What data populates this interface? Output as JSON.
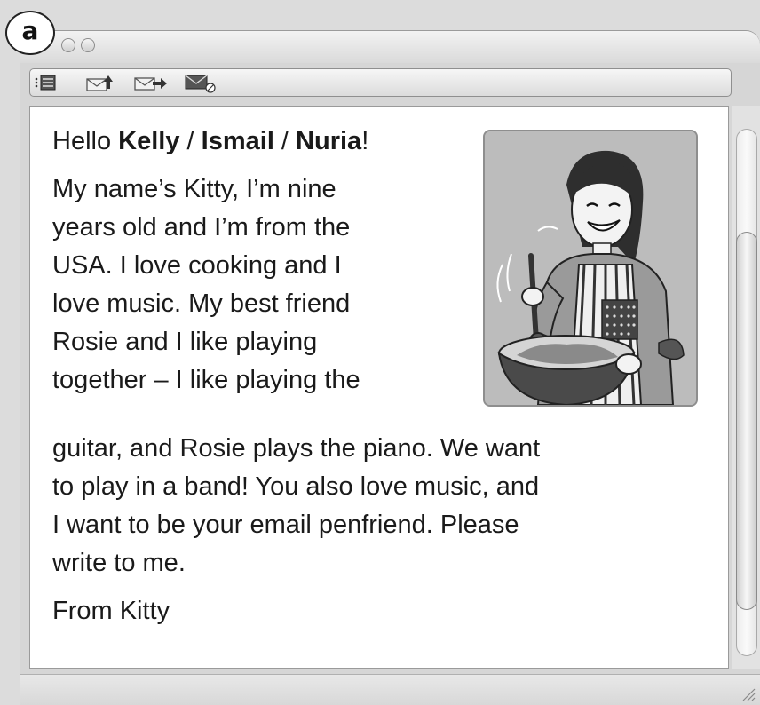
{
  "badge": {
    "label": "a"
  },
  "toolbar": {
    "icons": [
      "list-icon",
      "reply-icon",
      "forward-icon",
      "mail-icon"
    ]
  },
  "email": {
    "greeting_prefix": "Hello ",
    "greeting_name_1": "Kelly",
    "greeting_sep_1": " / ",
    "greeting_name_2": "Ismail",
    "greeting_sep_2": " / ",
    "greeting_name_3": "Nuria",
    "greeting_suffix": "!",
    "body_lines": [
      "My name’s Kitty, I’m nine",
      "years old and I’m from the",
      "USA. I love cooking and I",
      "love music. My best friend",
      "Rosie and I like playing",
      "together – I like playing the",
      "guitar, and Rosie plays the piano. We want",
      "to play in a band! You also love music, and",
      "I want to be your email penfriend. Please",
      "write to me."
    ],
    "sign_off": "From Kitty"
  },
  "illustration": {
    "icon": "girl-cooking-illustration"
  }
}
